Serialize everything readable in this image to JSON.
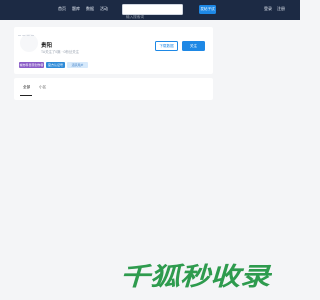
{
  "nav": {
    "links": [
      "首页",
      "题库",
      "数据",
      "活动"
    ],
    "search_placeholder": "输入搜索词",
    "post_button": "发帖子试",
    "right_links": [
      "登录",
      "注册"
    ]
  },
  "profile": {
    "username": "贵阳",
    "stats": "TA关注了0篇 · 0粉丝关注",
    "download_button": "下载数据",
    "follow_button": "关注",
    "badges": [
      "城市科普原创作者",
      "官方认证号",
      "活跃用户"
    ]
  },
  "tabs": {
    "items": [
      "全部",
      "小区"
    ],
    "active_index": 0
  },
  "watermark": {
    "text": "千狐秒收录"
  },
  "colors": {
    "nav_bg": "#1c2a44",
    "accent": "#1e88e5",
    "badge_purple": "#8a5cc7",
    "badge_blue": "#2f8bd8",
    "badge_light": "#d6e9fb",
    "watermark": "#2e9b4e"
  }
}
